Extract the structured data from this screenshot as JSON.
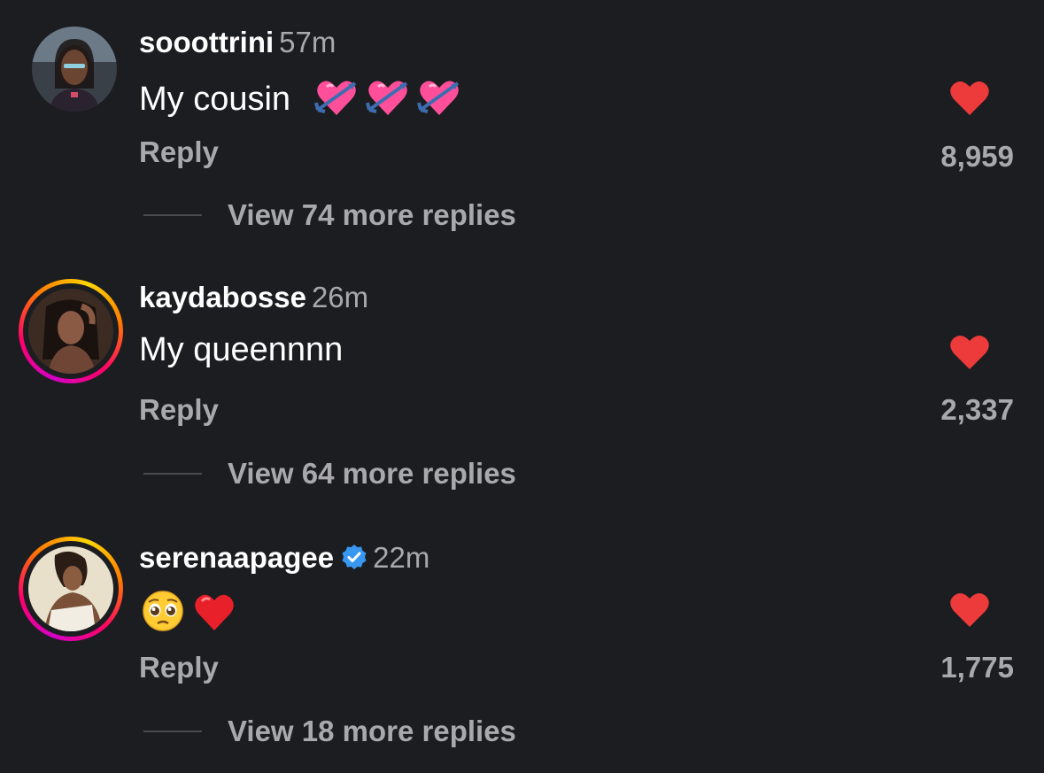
{
  "comments": [
    {
      "username": "sooottrini",
      "time": "57m",
      "text": "My cousin",
      "emoji": [
        "heart-with-arrow",
        "heart-with-arrow",
        "heart-with-arrow"
      ],
      "reply_label": "Reply",
      "likes": "8,959",
      "more_replies": "View 74 more replies",
      "verified": false,
      "story_ring": false
    },
    {
      "username": "kaydabosse",
      "time": "26m",
      "text": "My queennnn",
      "emoji": [],
      "reply_label": "Reply",
      "likes": "2,337",
      "more_replies": "View 64 more replies",
      "verified": false,
      "story_ring": true
    },
    {
      "username": "serenaapagee",
      "time": "22m",
      "text": "",
      "emoji": [
        "pleading-face",
        "red-heart"
      ],
      "reply_label": "Reply",
      "likes": "1,775",
      "more_replies": "View 18 more replies",
      "verified": true,
      "story_ring": true
    }
  ],
  "colors": {
    "background": "#1c1d21",
    "like_heart": "#ed3a3a",
    "secondary_text": "#a8a8ad",
    "verified_badge": "#3897f0"
  }
}
